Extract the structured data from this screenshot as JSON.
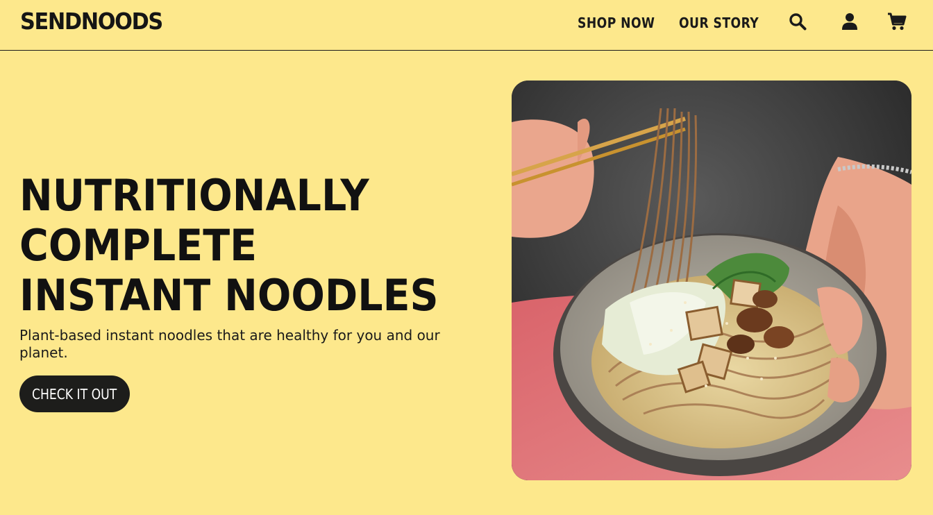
{
  "header": {
    "logo_text": "SENDNOODS",
    "nav": {
      "shop_now": "SHOP NOW",
      "our_story": "OUR STORY"
    },
    "icons": {
      "search": "search-icon",
      "account": "account-icon",
      "cart": "cart-icon"
    }
  },
  "hero": {
    "title": "NUTRITIONALLY COMPLETE INSTANT NOODLES",
    "subtitle": "Plant-based instant noodles that are healthy for you and our planet.",
    "cta_label": "CHECK IT OUT",
    "image_subject": "bowl-of-soba-noodles-with-bok-choy-tofu-mushrooms"
  },
  "colors": {
    "background": "#fde88c",
    "text": "#111111",
    "button_bg": "#1d1d1b",
    "button_text": "#ffffff"
  }
}
